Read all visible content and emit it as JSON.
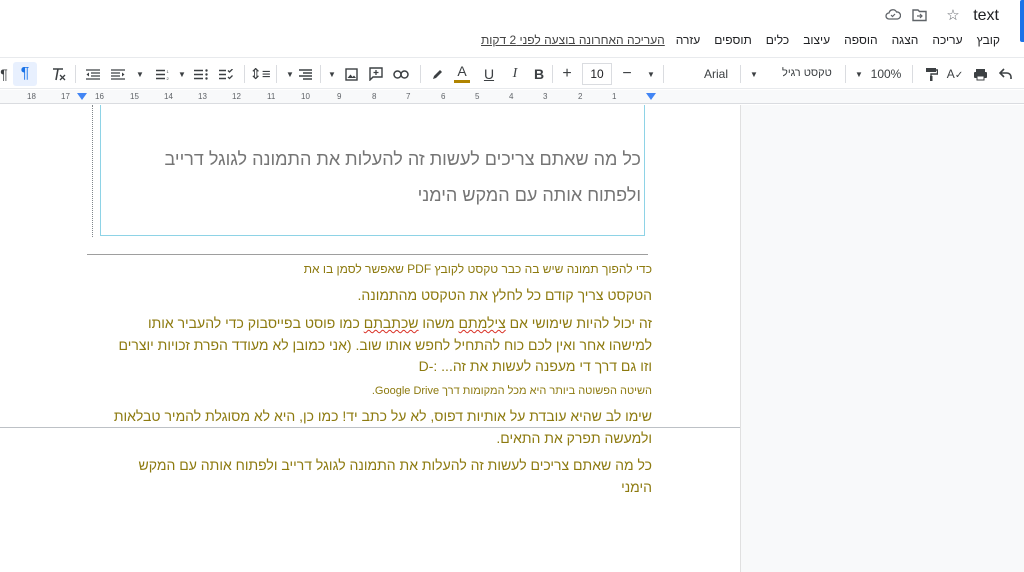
{
  "header": {
    "doc_title": "text",
    "last_edit": "העריכה האחרונה בוצעה לפני 2 דקות",
    "menu": [
      "קובץ",
      "עריכה",
      "הצגה",
      "הוספה",
      "עיצוב",
      "כלים",
      "תוספים",
      "עזרה"
    ]
  },
  "toolbar": {
    "zoom": "100%",
    "style": "טקסט רגיל",
    "font": "Arial",
    "font_size": "10",
    "bold": "B",
    "italic": "I",
    "underline": "U",
    "text_color": "A"
  },
  "ruler": {
    "numbers": [
      "18",
      "17",
      "16",
      "15",
      "14",
      "13",
      "12",
      "11",
      "10",
      "9",
      "8",
      "7",
      "6",
      "5",
      "4",
      "3",
      "2",
      "1"
    ]
  },
  "textbox": {
    "line1": "כל מה שאתם צריכים לעשות זה להעלות את התמונה לגוגל דרייב",
    "line2": "ולפתוח אותה עם המקש הימני"
  },
  "body": {
    "p1": "כדי להפוך תמונה שיש בה כבר טקסט לקובץ PDF שאפשר לסמן בו את",
    "p2": "הטקסט צריך קודם כל לחלץ את הטקסט מהתמונה.",
    "p3_a": "זה יכול להיות שימושי אם ",
    "p3_w1": "צילמתם",
    "p3_b": " משהו ",
    "p3_w2": "שכתבתם",
    "p3_c": " כמו פוסט בפייסבוק כדי להעביר אותו",
    "p4": "למישהו אחר ואין לכם כוח להתחיל לחפש אותו שוב. (אני כמובן לא מעודד הפרת זכויות יוצרים",
    "p5": "וזו גם דרך די מעפנה לעשות את זה... :-D",
    "p6": "השיטה הפשוטה ביותר היא מכל המקומות דרך Google Drive.",
    "p7": "שימו לב שהיא עובדת על אותיות דפוס, לא על כתב יד! כמו כן, היא לא מסוגלת להמיר טבלאות",
    "p8": "ולמעשה תפרק את התאים.",
    "p9": "כל מה שאתם צריכים לעשות זה להעלות את התמונה לגוגל דרייב ולפתוח אותה עם המקש",
    "p10": "הימני"
  },
  "colors": {
    "body_text": "#8d7a0f",
    "textbox_text": "#757575",
    "accent": "#1a73e8"
  }
}
